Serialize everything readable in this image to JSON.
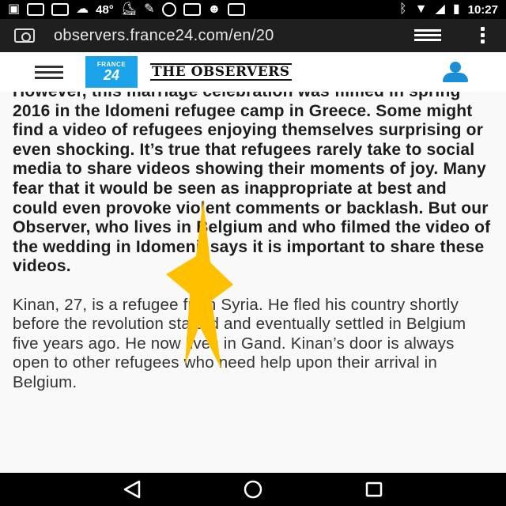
{
  "status_bar": {
    "temperature": "48°",
    "time": "10:27",
    "left_icons": [
      "chat-icon",
      "facebook-icon",
      "facebook-icon",
      "weather-icon",
      "temperature-text",
      "skate-icon",
      "wrench-icon",
      "gamepad-icon",
      "controller-icon",
      "cat-icon",
      "facebook-icon"
    ],
    "right_icons": [
      "bluetooth-icon",
      "wifi-icon",
      "signal-icon",
      "battery-icon"
    ]
  },
  "browser": {
    "url": "observers.france24.com/en/20"
  },
  "site_header": {
    "france24_line1": "FRANCE",
    "france24_line2": "24",
    "observers_logo": "THE OBSERVERS"
  },
  "article": {
    "lead_paragraph": "However, this marriage celebration was filmed in spring 2016 in the Idomeni refugee camp in Greece. Some might find a video of refugees enjoying themselves surprising or even shocking. It’s true that refugees rarely take to social media to share videos showing their moments of joy. Many fear that it would be seen as inappropriate at best and could even provoke violent comments or backlash. But our Observer, who lives in Belgium and who filmed the video of the wedding in Idomeni, says it is important to share these videos.",
    "body_paragraph": "Kinan, 27, is a refugee from Syria. He fled his country shortly before the revolution started and eventually settled in Belgium five years ago. He now lives in Gand. Kinan’s door is always open to other refugees who need help upon their arrival in Belgium."
  },
  "colors": {
    "france24_blue": "#1aa3e8",
    "user_icon_blue": "#1a8fd8",
    "cursor_yellow": "#ffc000",
    "article_bg": "#f9f9f9"
  },
  "nav_bar": {
    "buttons": [
      "back-icon",
      "home-icon",
      "recents-icon"
    ]
  }
}
